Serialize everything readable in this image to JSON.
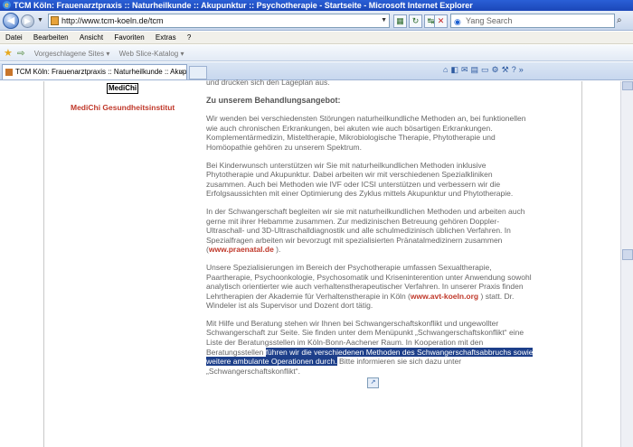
{
  "window": {
    "title": "TCM Köln: Frauenarztpraxis :: Naturheilkunde :: Akupunktur :: Psychotherapie - Startseite - Microsoft Internet Explorer"
  },
  "address_bar": {
    "url": "http://www.tcm-koeln.de/tcm",
    "search_placeholder": "Yang Search"
  },
  "menu": {
    "items": [
      "Datei",
      "Bearbeiten",
      "Ansicht",
      "Favoriten",
      "Extras",
      "?"
    ]
  },
  "favorites_bar": {
    "items": [
      "Vorgeschlagene Sites ▾",
      "Web Slice-Katalog ▾"
    ]
  },
  "tab": {
    "label": "TCM Köln: Frauenarztpraxis :: Naturheilkunde :: Akup..."
  },
  "page": {
    "logo_text": "MediChi",
    "side_label": "MediChi Gesundheitsinstitut",
    "top_line": "und drucken sich den Lageplan aus.",
    "heading": "Zu unserem Behandlungsangebot:",
    "p1": "Wir wenden bei verschiedensten Störungen naturheilkundliche Methoden an, bei funktionellen wie auch chronischen Erkrankungen, bei akuten wie auch bösartigen Erkrankungen. Komplementärmedizin, Misteltherapie, Mikrobiologische Therapie, Phytotherapie und Homöopathie gehören zu unserem Spektrum.",
    "p2": "Bei Kinderwunsch unterstützen wir Sie mit naturheilkundlichen Methoden inklusive Phytotherapie und Akupunktur. Dabei arbeiten wir mit verschiedenen Spezialkliniken zusammen. Auch bei Methoden wie IVF oder ICSI unterstützen und verbessern wir die Erfolgsaussichten mit einer Optimierung des Zyklus mittels Akupunktur und Phytotherapie.",
    "p3_text": "In der Schwangerschaft begleiten wir sie  mit naturheilkundlichen Methoden und arbeiten auch gerne mit ihrer Hebamme zusammen. Zur medizinischen Betreuung gehören Doppler-Ultraschall- und 3D-Ultraschalldiagnostik und alle schulmedizinisch üblichen Verfahren. In Spezialfragen arbeiten wir bevorzugt mit spezialisierten Pränatalmedizinern zusammen (",
    "p3_link": "www.praenatal.de",
    "p3_end": " ).",
    "p4_text": "Unsere Spezialisierungen im Bereich der Psychotherapie umfassen Sexualtherapie, Paartherapie, Psychoonkologie, Psychosomatik und Kriseninterention unter Anwendung sowohl analytisch orientierter wie auch verhaltenstherapeutischer Verfahren. In unserer Praxis finden Lehrtherapien der Akademie für Verhaltenstherapie in Köln (",
    "p4_link": "www.avt-koeln.org",
    "p4_end": " ) statt. Dr. Windeler ist als Supervisor und Dozent dort tätig.",
    "p5_start": "Mit Hilfe und Beratung stehen wir Ihnen bei Schwangerschaftskonflikt und ungewollter Schwangerschaft zur Seite. Sie finden unter dem Menüpunkt  „Schwangerschaftskonflikt“ eine Liste der Beratungsstellen im Köln-Bonn-Aachener Raum. In Kooperation mit den Beratungsstellen ",
    "p5_selected": "führen wir die verschiedenen Methoden des Schwangerschaftsabbruchs sowie weitere ambulante Operationen durch.",
    "p5_end": " Bitte informieren sie sich dazu unter „Schwangerschaftskonflikt“."
  }
}
